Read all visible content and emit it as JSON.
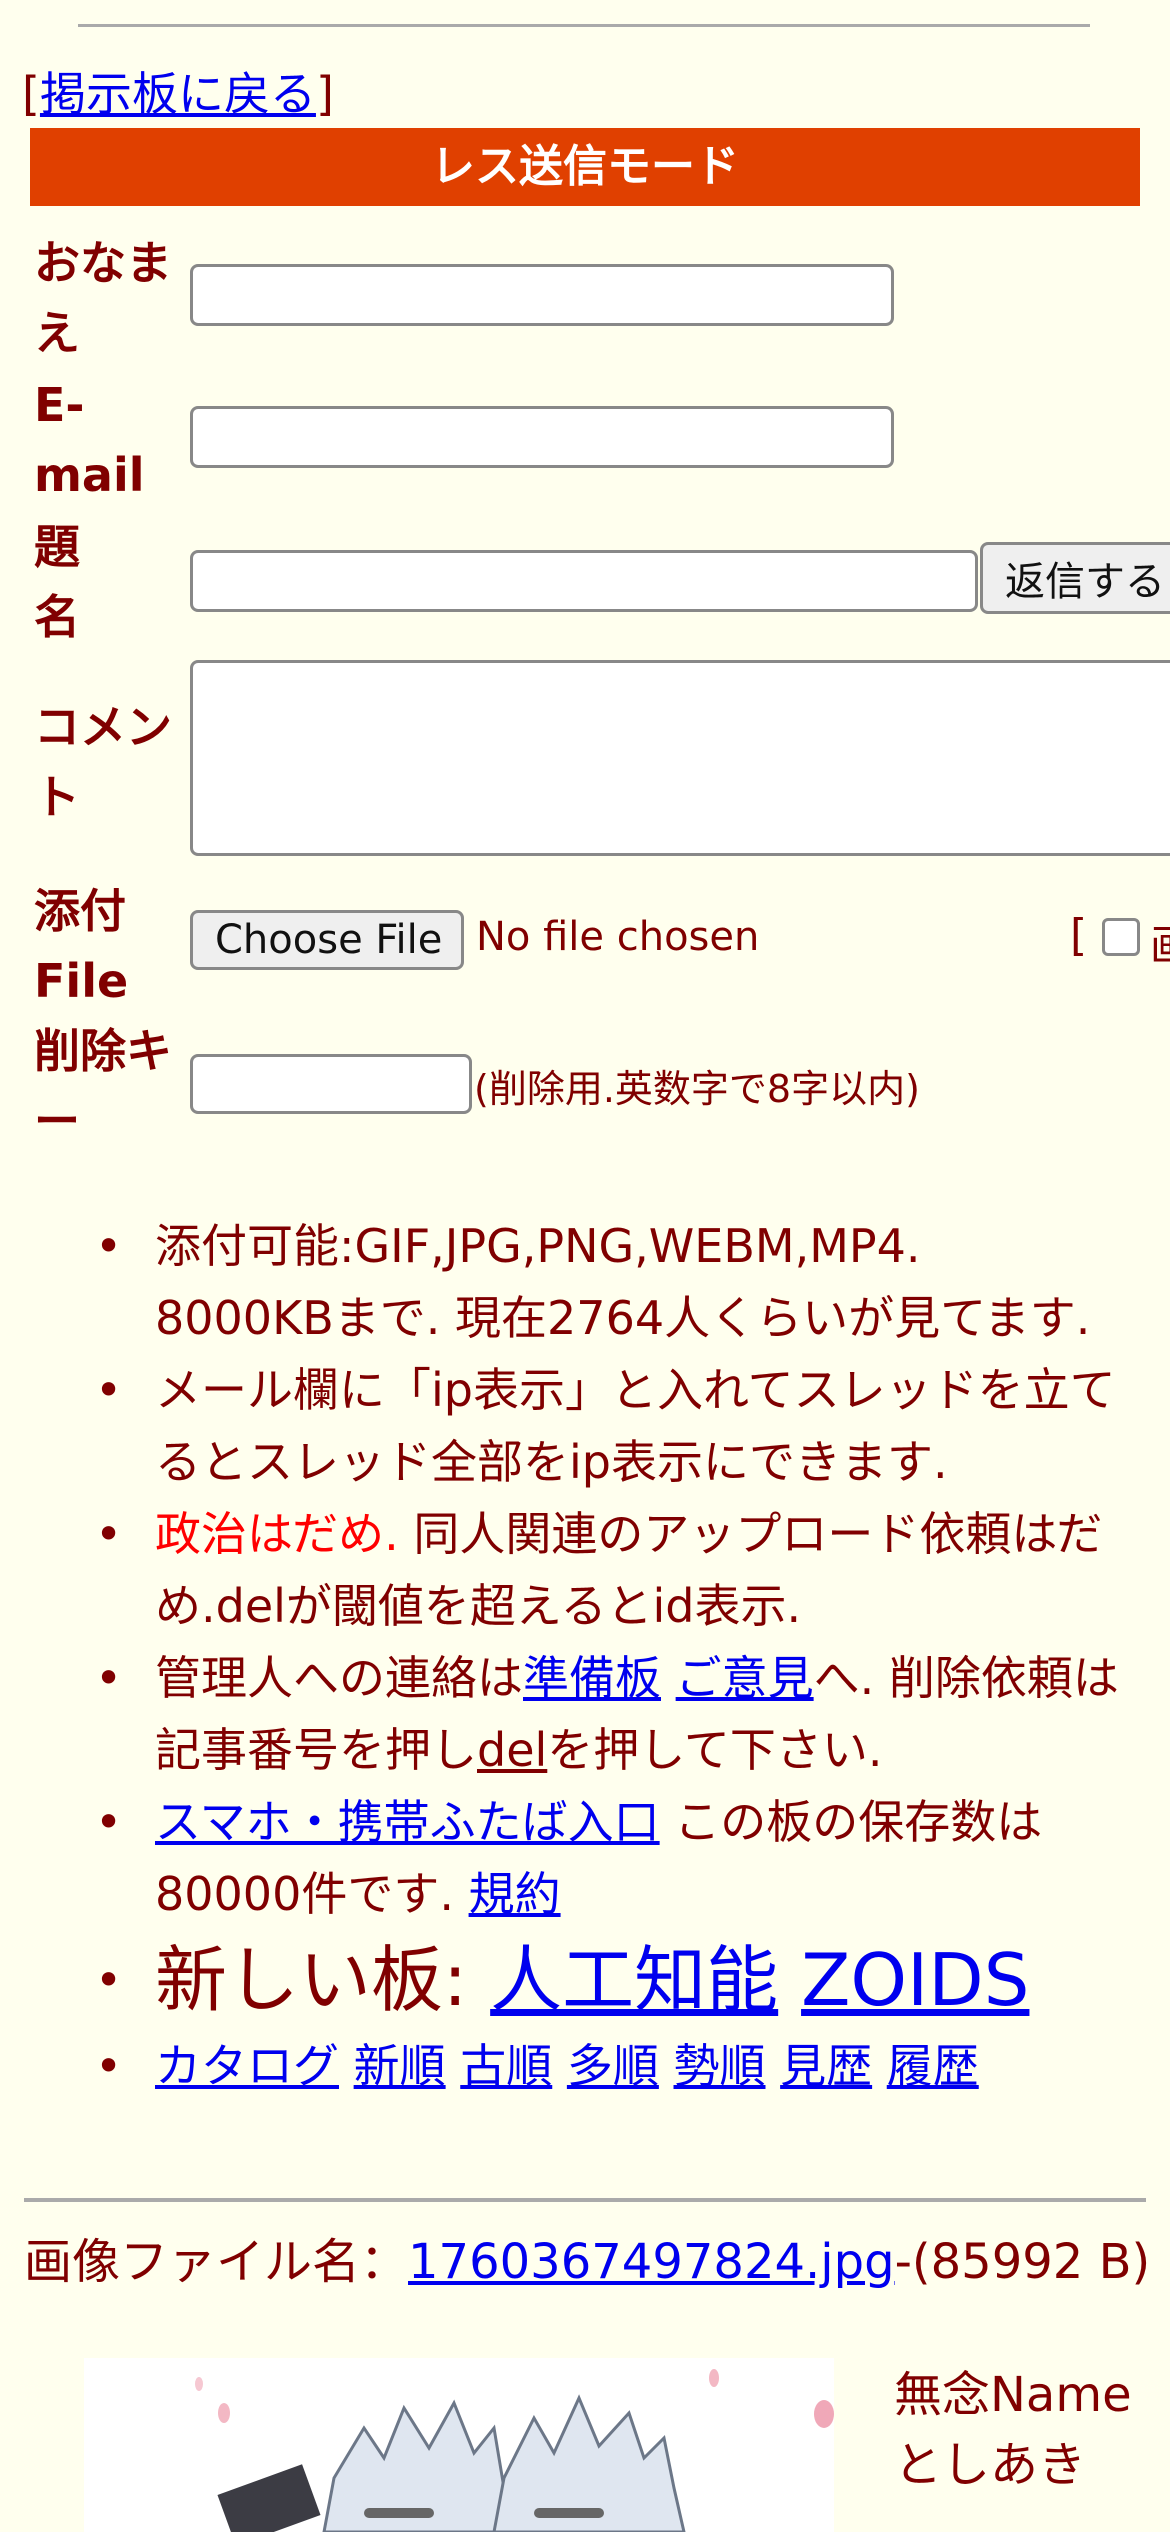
{
  "nav": {
    "bracket_open": "[",
    "back_link": "掲示板に戻る",
    "bracket_close": "]"
  },
  "mode_title": "レス送信モード",
  "form": {
    "name_label": "おなまえ",
    "email_label": "E-mail",
    "subject_label": "題名",
    "submit_button": "返信する",
    "comment_label": "コメント",
    "file_label": "添付File",
    "choose_file_button": "Choose File",
    "no_file_text": "No file chosen",
    "image_option_prefix": "[",
    "image_option_partial": "画",
    "delete_key_label": "削除キー",
    "delete_key_hint": "(削除用.英数字で8字以内)"
  },
  "notes": {
    "line1": "添付可能:GIF,JPG,PNG,WEBM,MP4.",
    "line1b": "8000KBまで. 現在2764人くらいが見てます.",
    "line2": "メール欄に「ip表示」と入れてスレッドを立てるとスレッド全部をip表示にできます.",
    "line3_red": "政治はだめ.",
    "line3_rest": " 同人関連のアップロード依頼はだめ.delが閾値を超えるとid表示.",
    "line4_pre": "管理人への連絡は",
    "line4_link1": "準備板",
    "line4_link2": "ご意見",
    "line4_mid": "へ. 削除依頼は記事番号を押し",
    "line4_del": "del",
    "line4_post": "を押して下さい.",
    "line5_link": "スマホ・携帯ふたば入口",
    "line5_mid": " この板の保存数は80000件です. ",
    "line5_terms": "規約",
    "new_boards_label": "新しい板: ",
    "new_board1": "人工知能",
    "new_board2": "ZOIDS",
    "sort_links": [
      "カタログ",
      "新順",
      "古順",
      "多順",
      "勢順",
      "見歴",
      "履歴"
    ]
  },
  "post": {
    "file_prefix": "画像ファイル名：",
    "file_link": "1760367497824.jpg",
    "file_size": "-(85992 B)",
    "poster_name": "無念Name",
    "poster_name2": "としあき"
  },
  "colors": {
    "background": "#ffffee",
    "text": "#800000",
    "mode_bar": "#e04000",
    "link": "#0000ee",
    "warning": "#ff0000"
  }
}
